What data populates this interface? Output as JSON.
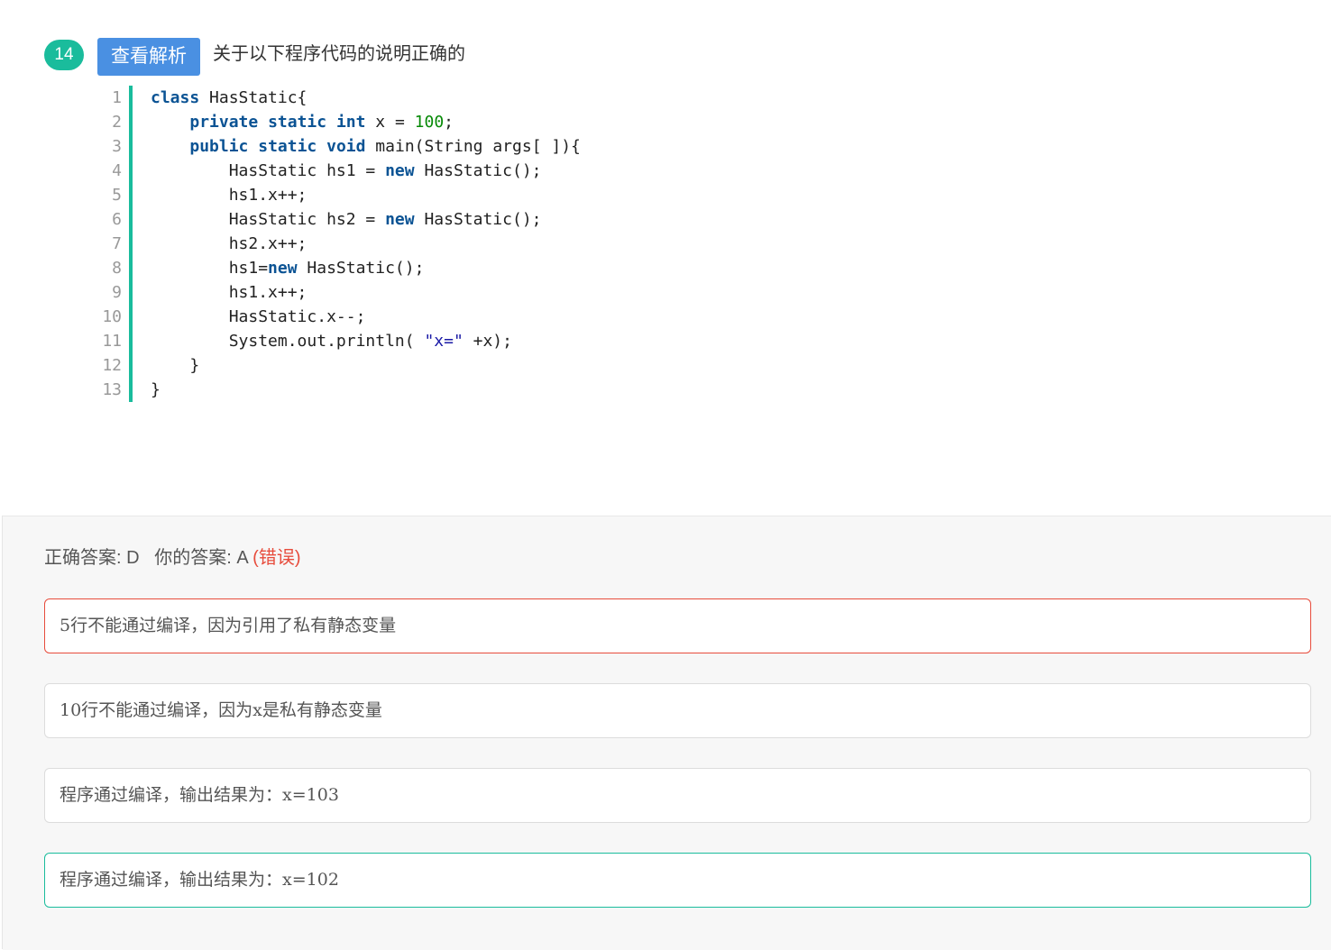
{
  "question": {
    "number": "14",
    "analysis_button": "查看解析",
    "title": "关于以下程序代码的说明正确的"
  },
  "code": {
    "language": "java",
    "lines": [
      "class HasStatic{",
      "    private static int x = 100;",
      "    public static void main(String args[ ]){",
      "        HasStatic hs1 = new HasStatic();",
      "        hs1.x++;",
      "        HasStatic hs2 = new HasStatic();",
      "        hs2.x++;",
      "        hs1=new HasStatic();",
      "        hs1.x++;",
      "        HasStatic.x--;",
      "        System.out.println( \"x=\" +x);",
      "    }",
      "}"
    ]
  },
  "answer": {
    "correct_label": "正确答案: D",
    "yours_label": "你的答案: A",
    "status": "(错误)"
  },
  "options": [
    {
      "text": "5行不能通过编译，因为引用了私有静态变量",
      "state": "selected-wrong"
    },
    {
      "text": "10行不能通过编译，因为x是私有静态变量",
      "state": "normal"
    },
    {
      "text": "程序通过编译，输出结果为：x=103",
      "state": "normal"
    },
    {
      "text": "程序通过编译，输出结果为：x=102",
      "state": "correct"
    }
  ],
  "colors": {
    "accent": "#1abc9c",
    "button": "#4a90e2",
    "wrong": "#e74c3c"
  }
}
